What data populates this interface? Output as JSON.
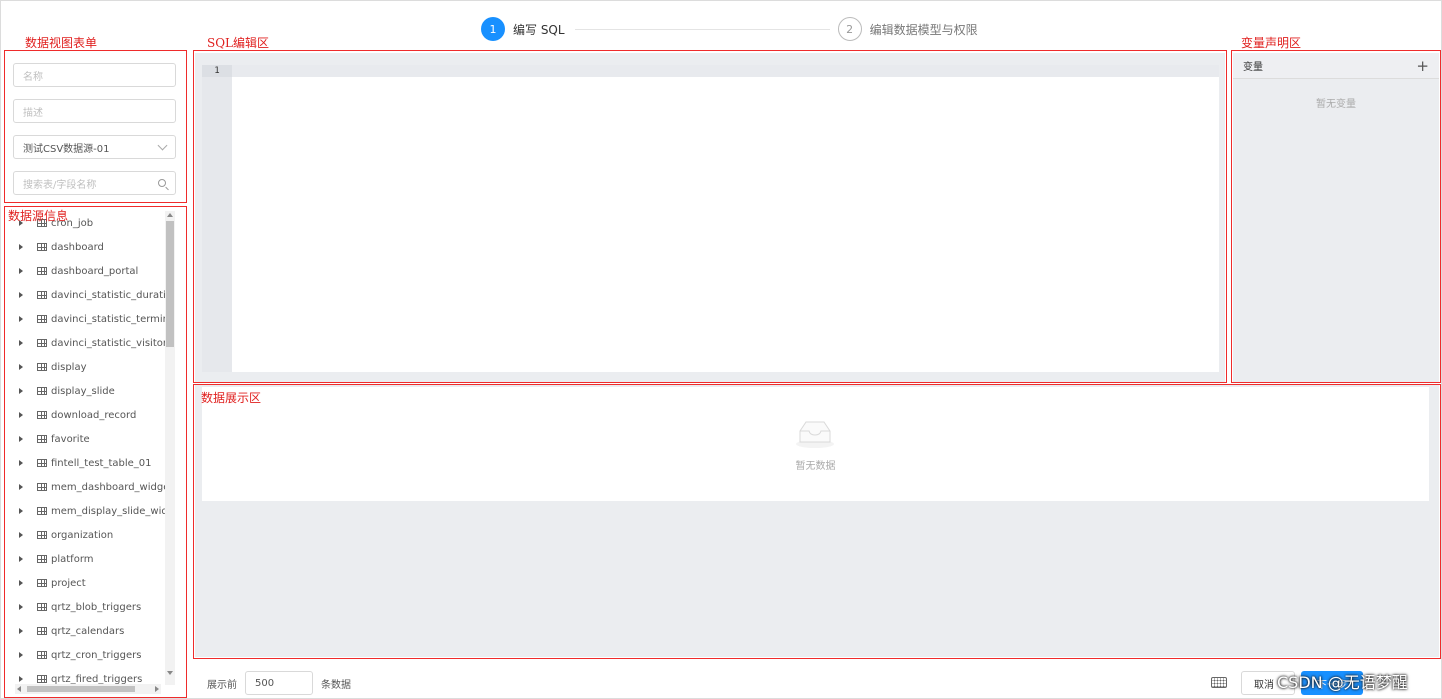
{
  "steps": [
    {
      "num": "1",
      "label": "编写 SQL",
      "state": "active"
    },
    {
      "num": "2",
      "label": "编辑数据模型与权限",
      "state": "todo"
    }
  ],
  "annotations": {
    "form": "数据视图表单",
    "sql_editor": "SQL编辑区",
    "variables": "变量声明区",
    "source_info": "数据源信息",
    "data_display": "数据展示区"
  },
  "form": {
    "name_placeholder": "名称",
    "desc_placeholder": "描述",
    "source_value": "测试CSV数据源-01",
    "search_placeholder": "搜索表/字段名称"
  },
  "tables": [
    "cron_job",
    "dashboard",
    "dashboard_portal",
    "davinci_statistic_duration",
    "davinci_statistic_terminal",
    "davinci_statistic_visitor_operation",
    "display",
    "display_slide",
    "download_record",
    "favorite",
    "fintell_test_table_01",
    "mem_dashboard_widget",
    "mem_display_slide_widget",
    "organization",
    "platform",
    "project",
    "qrtz_blob_triggers",
    "qrtz_calendars",
    "qrtz_cron_triggers",
    "qrtz_fired_triggers"
  ],
  "editor": {
    "line_number": "1"
  },
  "variables": {
    "header": "变量",
    "add": "+",
    "empty": "暂无变量"
  },
  "data_area": {
    "empty": "暂无数据"
  },
  "footer": {
    "prefix": "展示前",
    "limit": "500",
    "suffix": "条数据",
    "cancel": "取消",
    "next": "下一步"
  },
  "watermark": "CSDN @无语梦醒",
  "colors": {
    "accent": "#1890ff",
    "annotation": "#ef2b2b"
  }
}
